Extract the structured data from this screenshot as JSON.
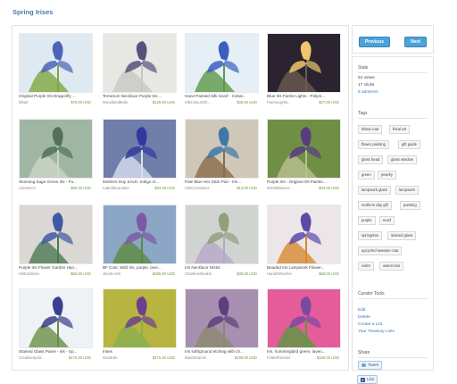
{
  "page": {
    "title": "Spring Irises"
  },
  "items": [
    {
      "title": "Original Purple Iris Dragonfly ...",
      "shop": "feltart",
      "price": "$75.00 USD",
      "palette": [
        "#dfe9f1",
        "#4c63b8",
        "#7ea83f"
      ]
    },
    {
      "title": "Terrarium Necklace Purple Iris ...",
      "shop": "WoodlandBelle",
      "price": "$125.00 USD",
      "palette": [
        "#e7e7e3",
        "#5b4f7e",
        "#c9c9c2"
      ]
    },
    {
      "title": "Hand Painted Silk Scarf - Cobal...",
      "shop": "SilkColours/D...",
      "price": "$35.50 USD",
      "palette": [
        "#e6eef6",
        "#3a5fbf",
        "#5c9a49"
      ]
    },
    {
      "title": "Blue Iris Faerie Lights - Polym...",
      "shop": "FaerieLights...",
      "price": "$27.00 USD",
      "palette": [
        "#2b2430",
        "#f0c66b",
        "#6a5b52"
      ]
    },
    {
      "title": "Stunning Sage Green Iris - Fu...",
      "shop": "cdvelenco",
      "price": "$65.00 USD",
      "palette": [
        "#9fb6a3",
        "#52705d",
        "#cbd6c8"
      ]
    },
    {
      "title": "Mothers Day SALE- Indigo Iri...",
      "shop": "LaBellaCandela",
      "price": "$33.49 USD",
      "palette": [
        "#6f7fa9",
        "#3139a0",
        "#d8dff0"
      ]
    },
    {
      "title": "Pale Blue Her Stick Pair - Iris...",
      "shop": "CMCCreations",
      "price": "$14.00 USD",
      "palette": [
        "#cfc7b8",
        "#3f78a8",
        "#8a6a48"
      ]
    },
    {
      "title": "Purple Iris - Original Oil Paintin...",
      "shop": "WorldWeaver...",
      "price": "$34.00 USD",
      "palette": [
        "#6f8f45",
        "#5b3a82",
        "#b9c08e"
      ]
    },
    {
      "title": "Purple Iris Flower Garden Han...",
      "shop": "HelbotGlass",
      "price": "$55.00 USD",
      "palette": [
        "#dad7d4",
        "#3f5aa3",
        "#4d7a52"
      ]
    },
    {
      "title": "BF Cost, Wild Iris, purple, lave...",
      "shop": "JanetLArts",
      "price": "$385.00 USD",
      "palette": [
        "#8ca6c5",
        "#7a5aa6",
        "#5c8a3f"
      ]
    },
    {
      "title": "Iris Necklace NG64",
      "shop": "CharleneDeakin",
      "price": "$35.00 USD",
      "palette": [
        "#d0d3cf",
        "#8fa07a",
        "#b7a7c8"
      ]
    },
    {
      "title": "Beaded Iris Lampwork Flower...",
      "shop": "HandshRachel",
      "price": "$58.00 USD",
      "palette": [
        "#ece6e9",
        "#5b4aa8",
        "#d98a2f"
      ]
    },
    {
      "title": "Stained Glass Panel - Iris - Sp...",
      "shop": "CreativeSpirit...",
      "price": "$175.00 USD",
      "palette": [
        "#eef2f4",
        "#3a3f8f",
        "#6c8e4a"
      ]
    },
    {
      "title": "Irises",
      "shop": "Gandolin",
      "price": "$275.00 USD",
      "palette": [
        "#b7b53f",
        "#6d3f8e",
        "#8ab04f"
      ]
    },
    {
      "title": "Iris soft/ground etching with ch...",
      "shop": "BlueDirtamin",
      "price": "$195.00 USD",
      "palette": [
        "#a78fb0",
        "#5d3f7e",
        "#8d8970"
      ]
    },
    {
      "title": "Iris, hummingbird green, laven...",
      "shop": "FeltedFancies",
      "price": "$160.00 USD",
      "palette": [
        "#e45c9a",
        "#7a4aa1",
        "#5c9a3f"
      ]
    }
  ],
  "nav": {
    "previous": "Previous",
    "next": "Next"
  },
  "stats": {
    "heading": "Stats",
    "views": "64 views",
    "clicks": "17 clicks",
    "admirers": "5 admirers"
  },
  "tags": {
    "heading": "Tags",
    "list": [
      "felted coat",
      "floral art",
      "flower painting",
      "gift guide",
      "glass bead",
      "glass window",
      "green",
      "jewelry",
      "lampwork glass",
      "lampwork",
      "mothers day gift",
      "painting",
      "purple",
      "scarf",
      "springtime",
      "stained glass",
      "upcycled sweater coat",
      "violet",
      "watercolor"
    ]
  },
  "curator": {
    "heading": "Curator Tools",
    "links": [
      "Edit",
      "Delete",
      "Create a List",
      "Your Treasury Lists"
    ]
  },
  "share": {
    "heading": "Share",
    "tweet": "Tweet",
    "like": "Like"
  }
}
